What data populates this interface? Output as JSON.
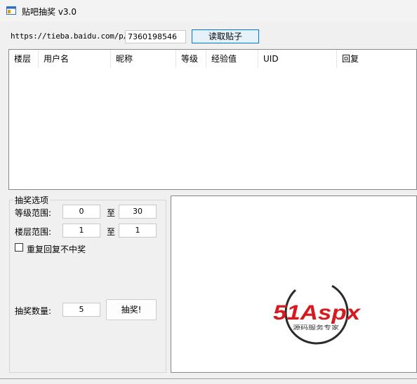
{
  "window": {
    "title": "贴吧抽奖 v3.0"
  },
  "url_bar": {
    "prefix": "https://tieba.baidu.com/p/",
    "post_id": "7360198546",
    "read_button": "读取贴子"
  },
  "table": {
    "columns": [
      {
        "label": "楼层"
      },
      {
        "label": "用户名"
      },
      {
        "label": "昵称"
      },
      {
        "label": "等级"
      },
      {
        "label": "经验值"
      },
      {
        "label": "UID"
      },
      {
        "label": "回复"
      }
    ]
  },
  "options": {
    "group_title": "抽奖选项",
    "level_range": {
      "label": "等级范围:",
      "from": "0",
      "sep": "至",
      "to": "30"
    },
    "floor_range": {
      "label": "楼层范围:",
      "from": "1",
      "sep": "至",
      "to": "1"
    },
    "no_repeat_label": "重复回复不中奖",
    "no_repeat_checked": false,
    "count": {
      "label": "抽奖数量:",
      "value": "5"
    },
    "draw_button": "抽奖!"
  },
  "logo": {
    "brand_text": "51Aspx",
    "tagline": "源码服务专家",
    "red": "#d71920",
    "green": "#3aa935"
  }
}
